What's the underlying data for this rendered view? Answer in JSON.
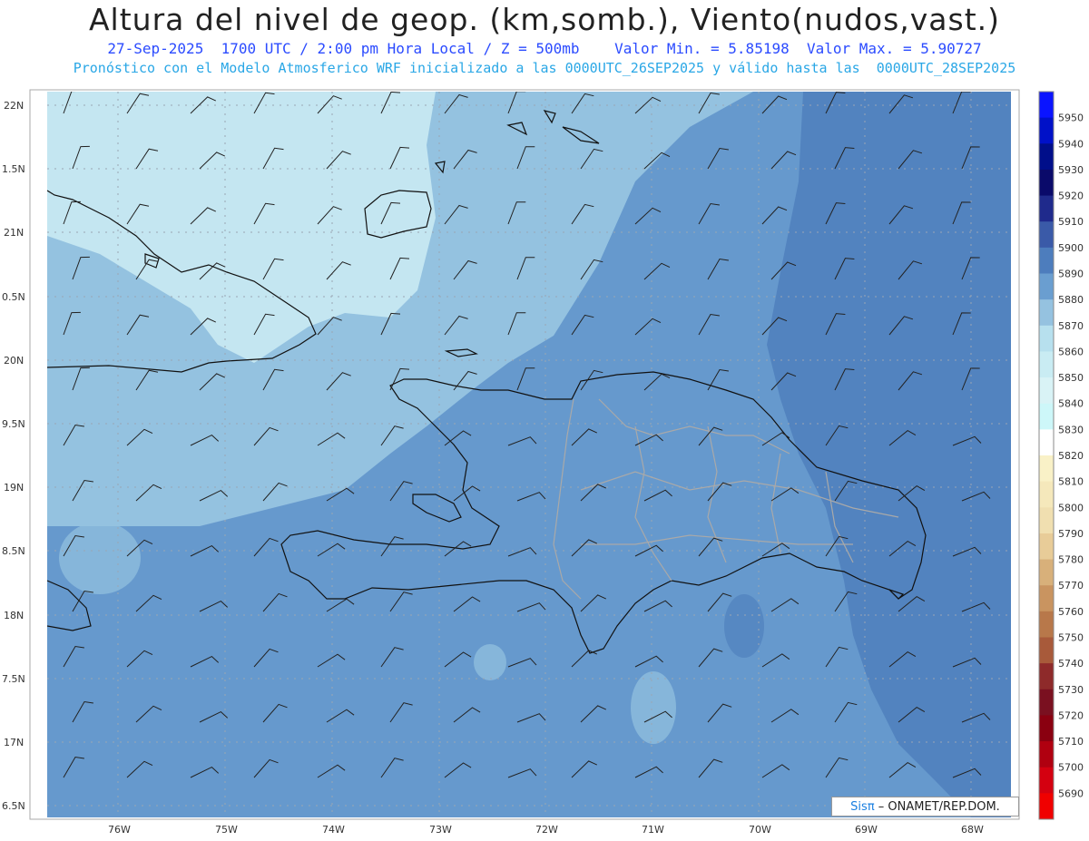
{
  "title": "Altura del nivel de geop. (km,somb.), Viento(nudos,vast.)",
  "subtitle1": "27-Sep-2025  1700 UTC / 2:00 pm Hora Local / Z = 500mb    Valor Min. = 5.85198  Valor Max. = 5.90727",
  "subtitle2": "Pronóstico con el Modelo Atmosferico WRF inicializado a las 0000UTC_26SEP2025 y válido hasta las  0000UTC_28SEP2025",
  "credit": {
    "brand": "Sis",
    "pi": "π",
    "text": "– ONAMET/REP.DOM."
  },
  "lat_labels": [
    "22N",
    "1.5N",
    "21N",
    "0.5N",
    "20N",
    "9.5N",
    "19N",
    "8.5N",
    "18N",
    "7.5N",
    "17N",
    "6.5N"
  ],
  "lon_labels": [
    "76W",
    "75W",
    "74W",
    "73W",
    "72W",
    "71W",
    "70W",
    "69W",
    "68W"
  ],
  "colorbar": {
    "labels": [
      "5950",
      "5940",
      "5930",
      "5920",
      "5910",
      "5900",
      "5890",
      "5880",
      "5870",
      "5860",
      "5850",
      "5840",
      "5830",
      "5820",
      "5810",
      "5800",
      "5790",
      "5780",
      "5770",
      "5760",
      "5750",
      "5740",
      "5730",
      "5720",
      "5710",
      "5700",
      "5690"
    ],
    "colors": [
      "#0a14ff",
      "#0011c8",
      "#000e8a",
      "#0a0a6a",
      "#1f2a8c",
      "#3a5aa8",
      "#4d7dbd",
      "#6a9ed0",
      "#95c2e0",
      "#b7e0ee",
      "#c9ecf3",
      "#d9f3f6",
      "#cdf7f9",
      "#ffffff",
      "#f9f1c7",
      "#f5e8bb",
      "#f0dfb0",
      "#e8cc98",
      "#d8b07a",
      "#c99460",
      "#b8784a",
      "#a85a3a",
      "#8e2a2a",
      "#7a1020",
      "#8a0010",
      "#b00010",
      "#d40010",
      "#f00000"
    ]
  },
  "fill_colors": {
    "level_5860": "#c4e6f1",
    "level_5870": "#94c2e0",
    "level_5880": "#6699cd",
    "level_5890": "#5283bf"
  }
}
